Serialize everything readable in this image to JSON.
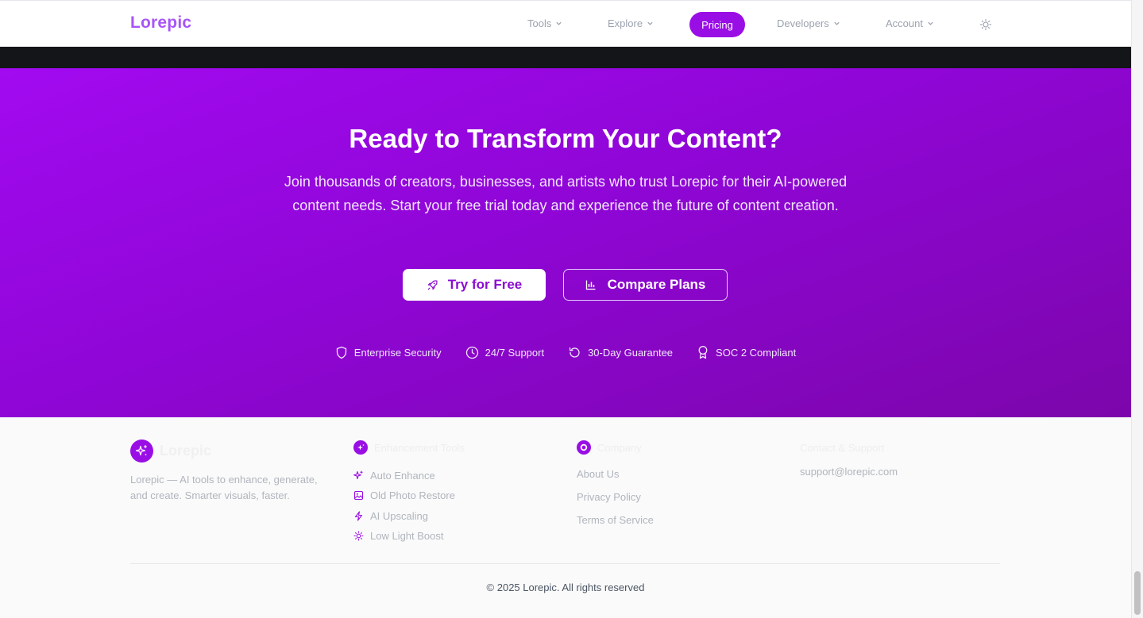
{
  "nav": {
    "logo": "Lorepic",
    "items": [
      {
        "label": "Tools"
      },
      {
        "label": "Explore"
      },
      {
        "label": "Pricing"
      },
      {
        "label": "Developers"
      },
      {
        "label": "Account"
      }
    ]
  },
  "hero": {
    "title": "Ready to Transform Your Content?",
    "subtitle": "Join thousands of creators, businesses, and artists who trust Lorepic for their AI-powered content needs. Start your free trial today and experience the future of content creation.",
    "primary_button": "Try for Free",
    "secondary_button": "Compare Plans",
    "badges": [
      {
        "label": "Enterprise Security",
        "icon": "shield-icon"
      },
      {
        "label": "24/7 Support",
        "icon": "clock-icon"
      },
      {
        "label": "30-Day Guarantee",
        "icon": "refresh-icon"
      },
      {
        "label": "SOC 2 Compliant",
        "icon": "award-icon"
      }
    ]
  },
  "footer": {
    "brand_name": "Lorepic",
    "description": "Lorepic — AI tools to enhance, generate, and create. Smarter visuals, faster.",
    "enhancement": {
      "heading": "Enhancement Tools",
      "items": [
        {
          "label": "Auto Enhance",
          "icon": "sparkles-icon"
        },
        {
          "label": "Old Photo Restore",
          "icon": "image-icon"
        },
        {
          "label": "AI Upscaling",
          "icon": "bolt-icon"
        },
        {
          "label": "Low Light Boost",
          "icon": "sun-icon"
        }
      ]
    },
    "company": {
      "heading": "Company",
      "links": [
        "About Us",
        "Privacy Policy",
        "Terms of Service"
      ]
    },
    "contact": {
      "heading": "Contact & Support",
      "email": "support@lorepic.com"
    },
    "copyright": "© 2025 Lorepic. All rights reserved"
  },
  "colors": {
    "accent": "#9a0ee6",
    "hero_gradient_start": "#a20af0",
    "hero_gradient_end": "#7c06ab"
  }
}
